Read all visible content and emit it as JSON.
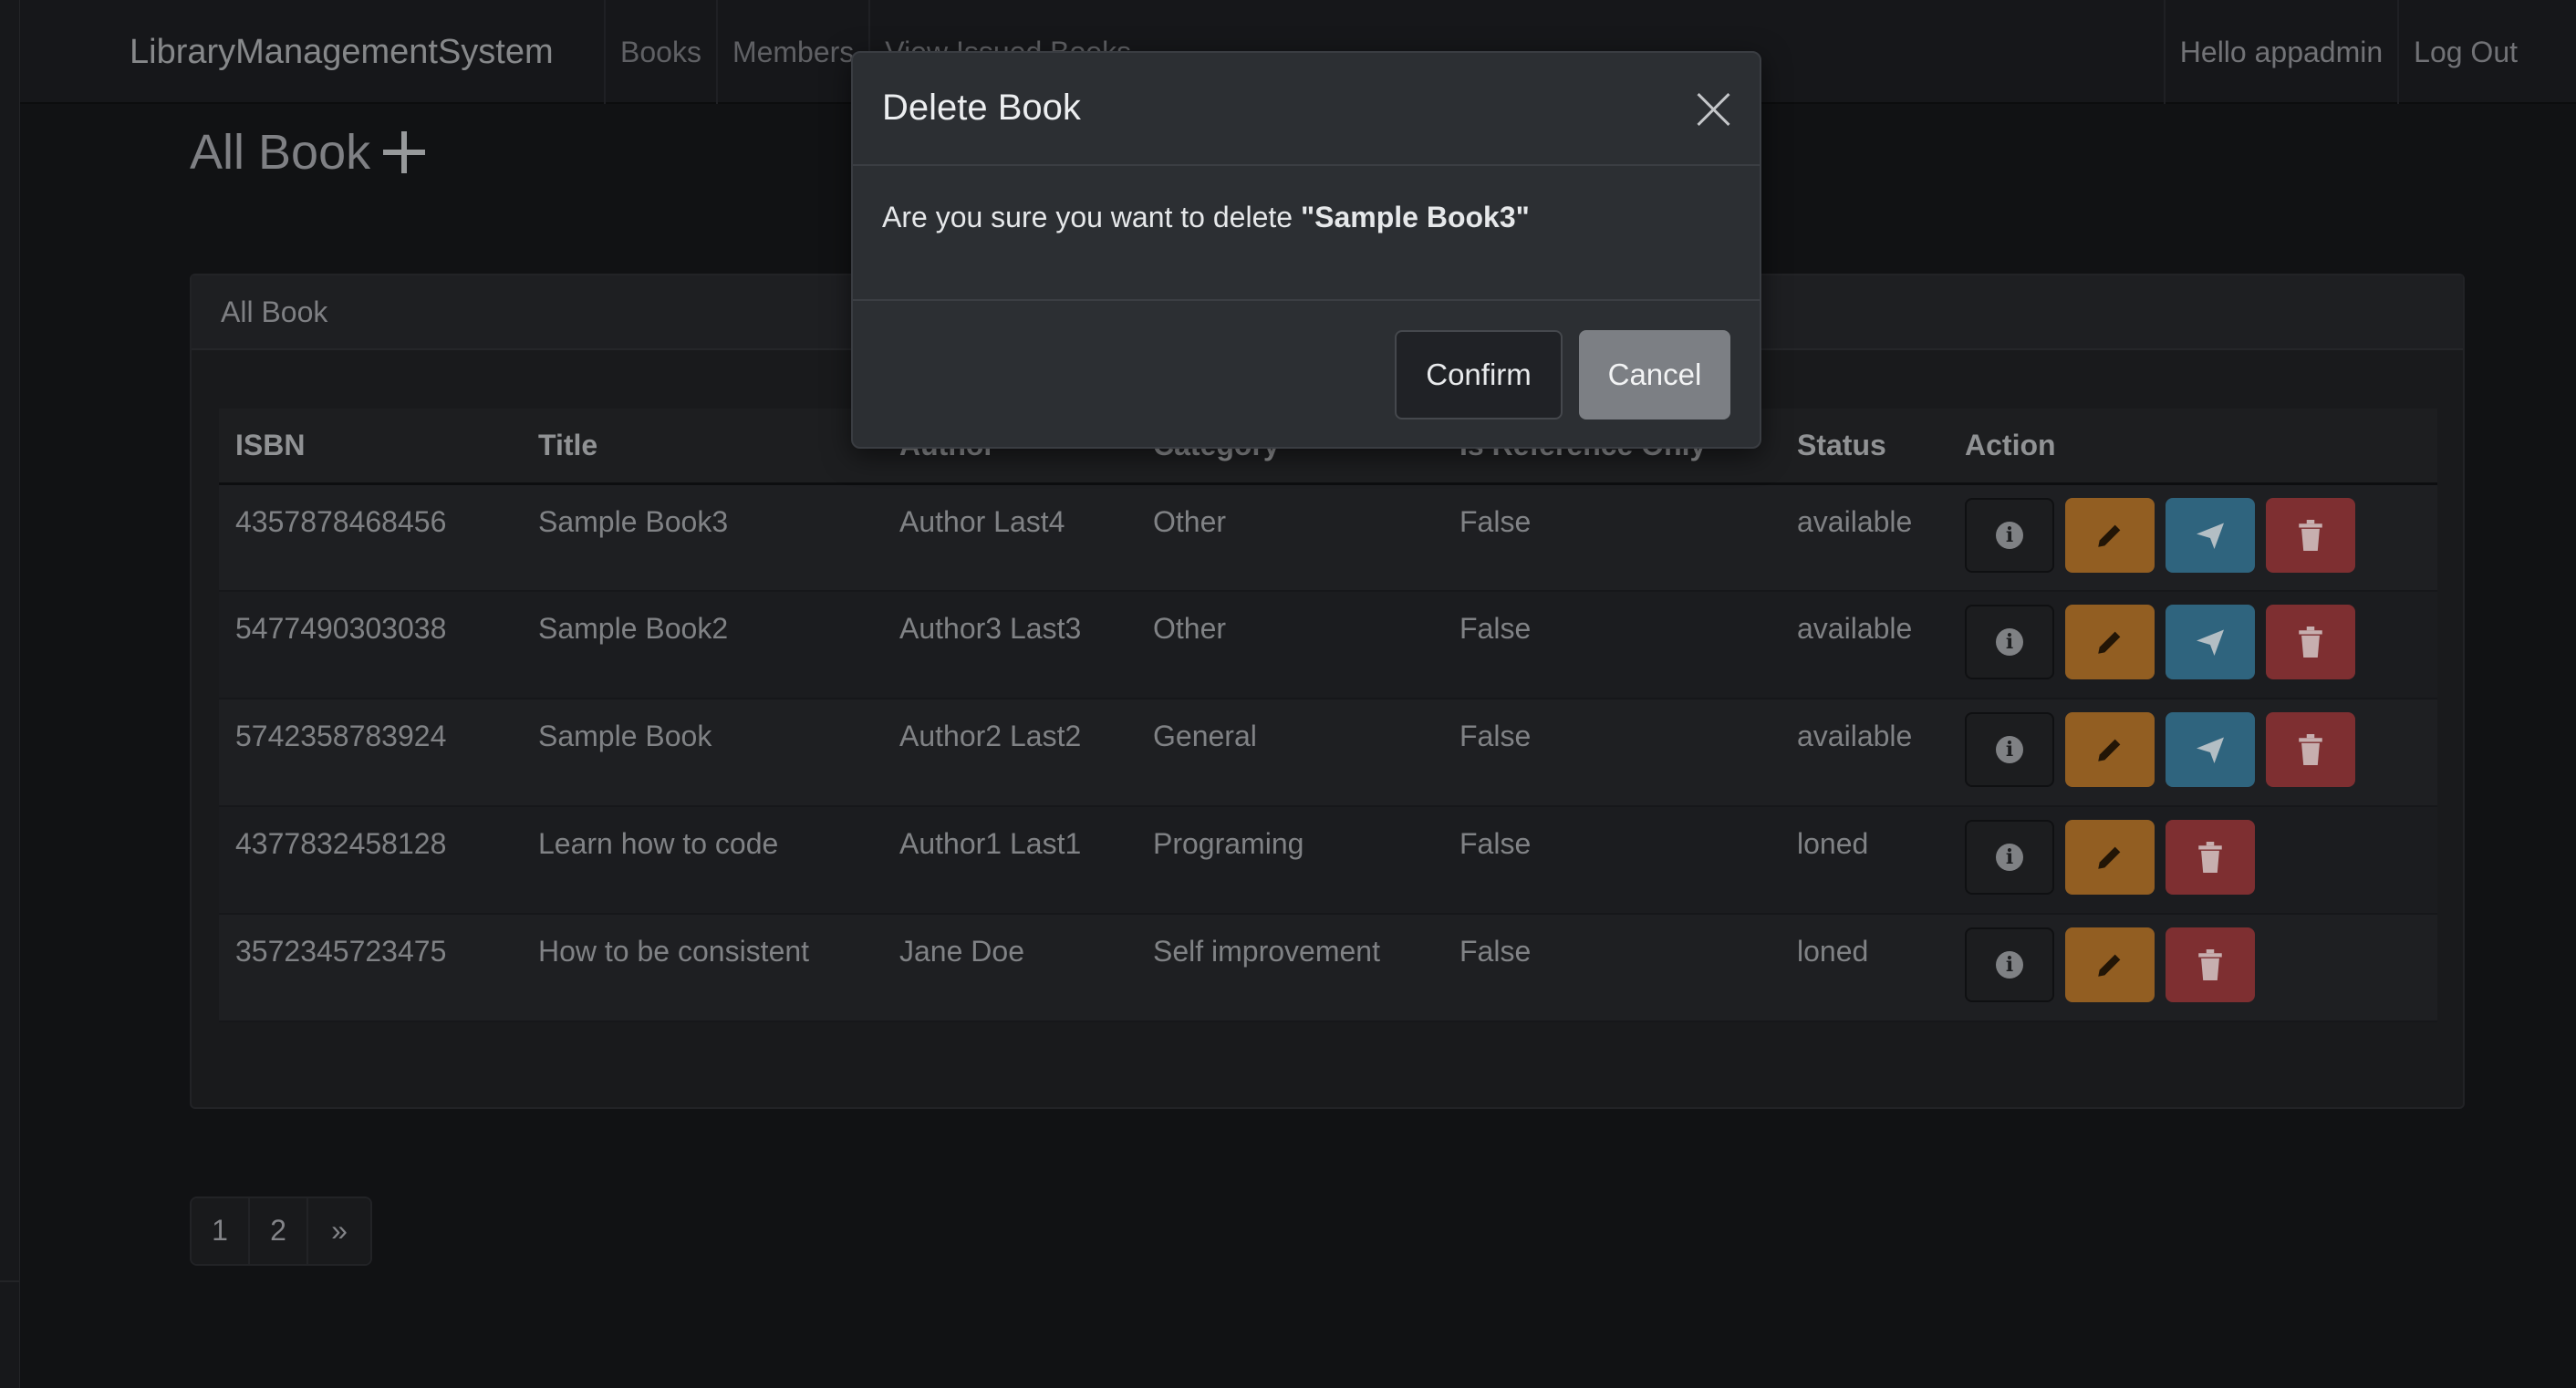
{
  "navbar": {
    "brand": "LibraryManagementSystem",
    "links": [
      "Books",
      "Members",
      "View Issued Books"
    ],
    "greeting": "Hello appadmin",
    "logout": "Log Out"
  },
  "page": {
    "title": "All Book",
    "add_icon": "plus-icon"
  },
  "card": {
    "header": "All Book",
    "columns": [
      "ISBN",
      "Title",
      "Author",
      "Category",
      "Is Reference Only",
      "Status",
      "Action"
    ],
    "rows": [
      {
        "isbn": "4357878468456",
        "title": "Sample Book3",
        "author": "Author Last4",
        "category": "Other",
        "reference": "False",
        "status": "available",
        "actions": [
          "info",
          "edit",
          "issue",
          "delete"
        ]
      },
      {
        "isbn": "5477490303038",
        "title": "Sample Book2",
        "author": "Author3 Last3",
        "category": "Other",
        "reference": "False",
        "status": "available",
        "actions": [
          "info",
          "edit",
          "issue",
          "delete"
        ]
      },
      {
        "isbn": "5742358783924",
        "title": "Sample Book",
        "author": "Author2 Last2",
        "category": "General",
        "reference": "False",
        "status": "available",
        "actions": [
          "info",
          "edit",
          "issue",
          "delete"
        ]
      },
      {
        "isbn": "4377832458128",
        "title": "Learn how to code",
        "author": "Author1 Last1",
        "category": "Programing",
        "reference": "False",
        "status": "loned",
        "actions": [
          "info",
          "edit",
          "delete"
        ]
      },
      {
        "isbn": "3572345723475",
        "title": "How to be consistent",
        "author": "Jane Doe",
        "category": "Self improvement",
        "reference": "False",
        "status": "loned",
        "actions": [
          "info",
          "edit",
          "delete"
        ]
      }
    ]
  },
  "pagination": [
    "1",
    "2",
    "»"
  ],
  "modal": {
    "title": "Delete Book",
    "message_prefix": "Are you sure you want to delete ",
    "message_target": "\"Sample Book3\"",
    "confirm_label": "Confirm",
    "cancel_label": "Cancel",
    "close_icon": "close-icon"
  },
  "colors": {
    "edit": "#b2732a",
    "issue": "#3a7a9a",
    "delete": "#9a3a3c",
    "cancel": "#7c7f84"
  }
}
